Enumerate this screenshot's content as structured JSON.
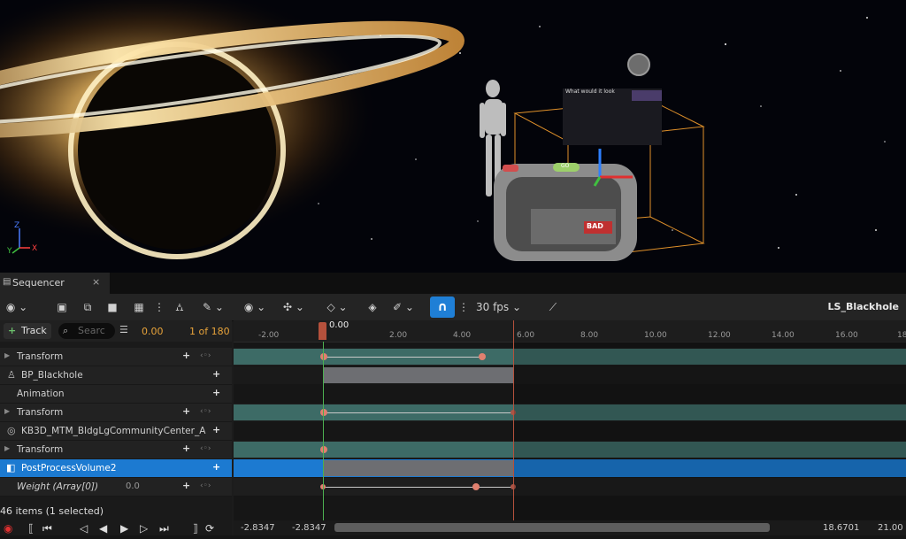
{
  "viewport": {
    "poster_text": "What would it look",
    "board_label": "BAD",
    "sign_label": "GO",
    "axis": {
      "y": "Y",
      "x": "X",
      "z": "Z"
    }
  },
  "tab": {
    "title": "Sequencer",
    "close": "×"
  },
  "toolbar": {
    "fps": "30 fps",
    "sequence_name": "LS_Blackhole"
  },
  "filter": {
    "add_track_label": "Track",
    "search_placeholder": "Searc",
    "current_time": "0.00",
    "frame_counter": "1 of 180"
  },
  "ruler": {
    "playhead_time": "0.00",
    "ticks": [
      "-2.00",
      "2.00",
      "4.00",
      "6.00",
      "8.00",
      "10.00",
      "12.00",
      "14.00",
      "16.00",
      "18"
    ]
  },
  "tracks": [
    {
      "label": "Transform",
      "type": "transform"
    },
    {
      "label": "BP_Blackhole",
      "type": "actor"
    },
    {
      "label": "Animation",
      "type": "sub"
    },
    {
      "label": "Transform",
      "type": "transform"
    },
    {
      "label": "KB3D_MTM_BldgLgCommunityCenter_A",
      "type": "actor"
    },
    {
      "label": "Transform",
      "type": "transform"
    },
    {
      "label": "PostProcessVolume2",
      "type": "actor",
      "selected": true
    },
    {
      "label": "Weight (Array[0])",
      "type": "property",
      "value": "0.0"
    }
  ],
  "status": {
    "items_text": "46 items (1 selected)"
  },
  "bottom": {
    "view_start": "-2.8347",
    "work_start": "-2.8347",
    "view_end": "18.6701",
    "work_end": "21.00"
  },
  "colors": {
    "accent": "#1c7ad1",
    "section_teal": "#3d6b66",
    "section_gray": "#6d6e72",
    "key": "#e0806f",
    "playhead": "#b5513c"
  }
}
